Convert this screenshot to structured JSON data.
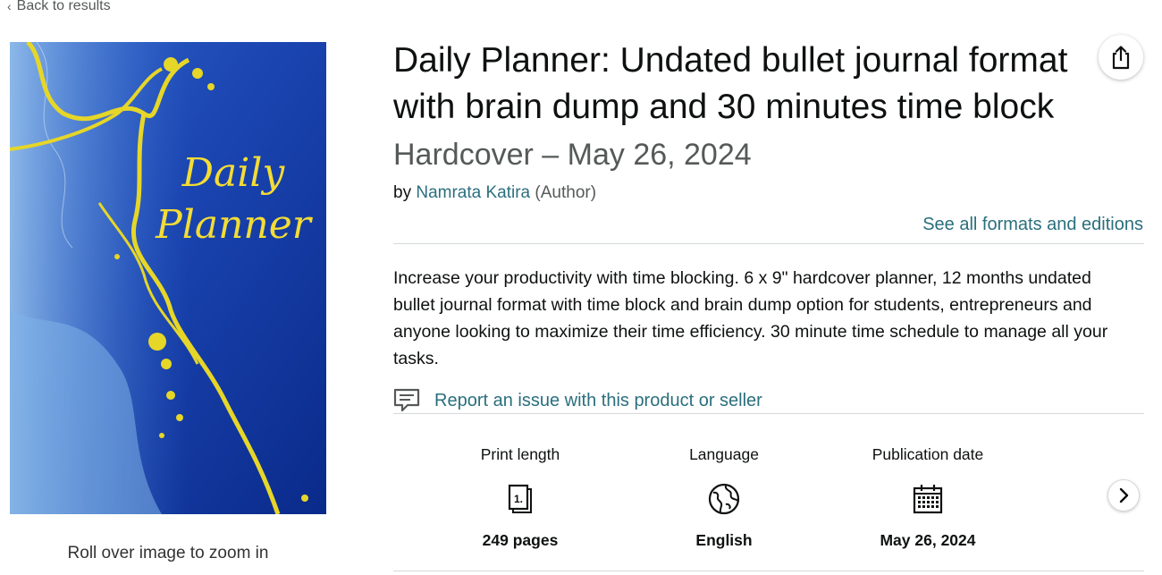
{
  "nav": {
    "back_label": "Back to results"
  },
  "cover": {
    "title_line1": "Daily",
    "title_line2": "Planner",
    "accent_color": "#f3dc35",
    "background_color": "#0a2a8a"
  },
  "image": {
    "zoom_hint": "Roll over image to zoom in"
  },
  "product": {
    "title": "Daily Planner: Undated bullet journal format with brain dump and 30 minutes time block",
    "binding": "Hardcover – May 26, 2024",
    "by_label": "by",
    "author": "Namrata Katira",
    "author_role": "(Author)",
    "formats_link": "See all formats and editions",
    "description": "Increase your productivity with time blocking. 6 x 9\" hardcover planner, 12 months undated bullet journal format with time block and brain dump option for students, entrepreneurs and anyone looking to maximize their time efficiency. 30 minute time schedule to manage all your tasks.",
    "report_link": "Report an issue with this product or seller"
  },
  "attributes": [
    {
      "label": "Print length",
      "value": "249 pages",
      "icon": "book-pages-icon"
    },
    {
      "label": "Language",
      "value": "English",
      "icon": "globe-icon"
    },
    {
      "label": "Publication date",
      "value": "May 26, 2024",
      "icon": "calendar-icon"
    }
  ],
  "icons": {
    "share": "share-icon",
    "next": "chevron-right-icon",
    "report": "speech-bubble-icon"
  },
  "colors": {
    "link": "#2a6f7d",
    "muted": "#565959",
    "divider": "#d5d9d9"
  }
}
